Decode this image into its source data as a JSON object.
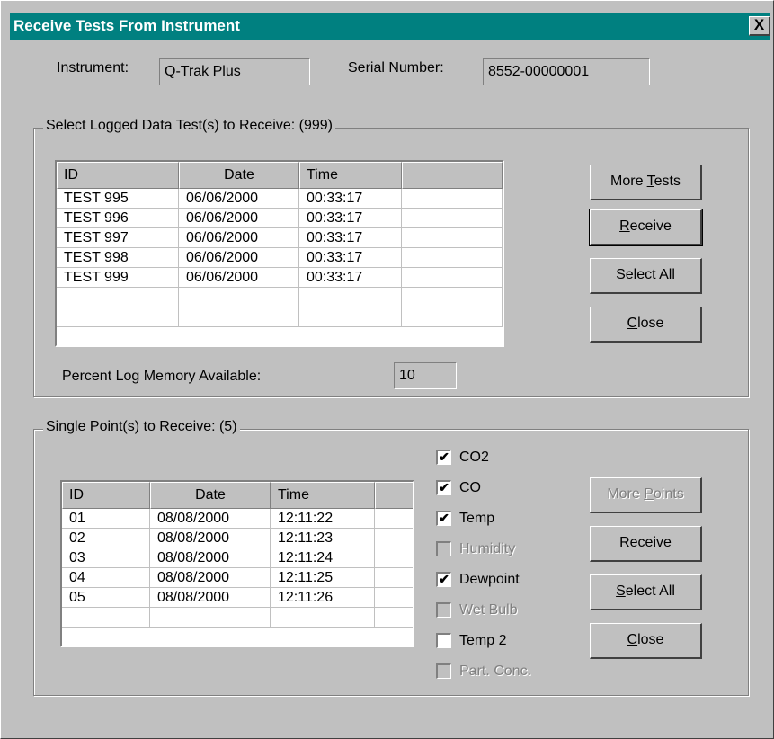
{
  "window": {
    "title": "Receive Tests From Instrument",
    "close_glyph": "X"
  },
  "info": {
    "instrument_label": "Instrument:",
    "instrument_value": "Q-Trak Plus",
    "serial_label": "Serial Number:",
    "serial_value": "8552-00000001"
  },
  "logged": {
    "group_label": "Select Logged Data Test(s) to Receive: (999)",
    "headers": [
      "ID",
      "Date",
      "Time",
      ""
    ],
    "rows": [
      [
        "TEST 995",
        "06/06/2000",
        "00:33:17"
      ],
      [
        "TEST 996",
        "06/06/2000",
        "00:33:17"
      ],
      [
        "TEST 997",
        "06/06/2000",
        "00:33:17"
      ],
      [
        "TEST 998",
        "06/06/2000",
        "00:33:17"
      ],
      [
        "TEST 999",
        "06/06/2000",
        "00:33:17"
      ]
    ],
    "memory_label": "Percent Log Memory Available:",
    "memory_value": "10",
    "buttons": {
      "more": {
        "pre": "More ",
        "key": "T",
        "post": "ests"
      },
      "receive": {
        "pre": "",
        "key": "R",
        "post": "eceive"
      },
      "select_all": {
        "pre": "",
        "key": "S",
        "post": "elect All"
      },
      "close": {
        "pre": "",
        "key": "C",
        "post": "lose"
      }
    }
  },
  "single": {
    "group_label": "Single Point(s) to Receive: (5)",
    "headers": [
      "ID",
      "Date",
      "Time",
      ""
    ],
    "rows": [
      [
        "01",
        "08/08/2000",
        "12:11:22"
      ],
      [
        "02",
        "08/08/2000",
        "12:11:23"
      ],
      [
        "03",
        "08/08/2000",
        "12:11:24"
      ],
      [
        "04",
        "08/08/2000",
        "12:11:25"
      ],
      [
        "05",
        "08/08/2000",
        "12:11:26"
      ]
    ],
    "checkboxes": [
      {
        "label": "CO2",
        "checked": true,
        "enabled": true
      },
      {
        "label": "CO",
        "checked": true,
        "enabled": true
      },
      {
        "label": "Temp",
        "checked": true,
        "enabled": true
      },
      {
        "label": "Humidity",
        "checked": false,
        "enabled": false
      },
      {
        "label": "Dewpoint",
        "checked": true,
        "enabled": true
      },
      {
        "label": "Wet Bulb",
        "checked": false,
        "enabled": false
      },
      {
        "label": "Temp 2",
        "checked": false,
        "enabled": true
      },
      {
        "label": "Part. Conc.",
        "checked": false,
        "enabled": false
      }
    ],
    "buttons": {
      "more": {
        "pre": "More ",
        "key": "P",
        "post": "oints",
        "enabled": false
      },
      "receive": {
        "pre": "",
        "key": "R",
        "post": "eceive"
      },
      "select_all": {
        "pre": "",
        "key": "S",
        "post": "elect All"
      },
      "close": {
        "pre": "",
        "key": "C",
        "post": "lose"
      }
    }
  },
  "check_glyph": "✔"
}
